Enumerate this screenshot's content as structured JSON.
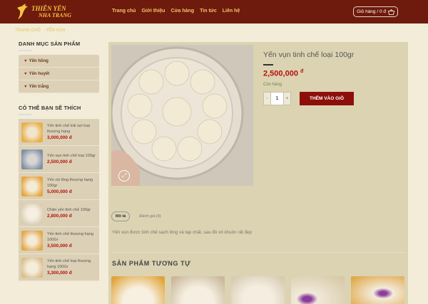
{
  "brand": {
    "line1": "THIÊN YẾN",
    "line2": "NHA TRANG"
  },
  "nav": [
    "Trang chủ",
    "Giới thiệu",
    "Cửa hàng",
    "Tin tức",
    "Liên hệ"
  ],
  "cart": {
    "label": "Giỏ hàng / 0 đ"
  },
  "breadcrumb": [
    "TRANG CHỦ",
    "YẾN VỤN"
  ],
  "sidebar": {
    "categories_title": "DANH MỤC SẢN PHẨM",
    "categories": [
      "Yến hồng",
      "Yến huyết",
      "Yến trắng"
    ],
    "suggest_title": "CÓ THỂ BẠN SẼ THÍCH",
    "products": [
      {
        "name": "Yến tinh chế trải sợi loại thượng hạng",
        "price": "3,000,000 đ"
      },
      {
        "name": "Yến vụn tinh chế loại 100gr",
        "price": "2,500,000 đ"
      },
      {
        "name": "Yến rút lông thượng hạng 100gr",
        "price": "5,000,000 đ"
      },
      {
        "name": "Chân yến tinh chế 100gr",
        "price": "2,800,000 đ"
      },
      {
        "name": "Yến tinh chế thượng hạng 100Gr",
        "price": "3,500,000 đ"
      },
      {
        "name": "Yến tinh chế loại thượng hạng 100Gr",
        "price": "3,300,000 đ"
      }
    ]
  },
  "product": {
    "title": "Yến vụn tinh chế loại 100gr",
    "price": "2,500,000",
    "currency": "đ",
    "stock": "Còn hàng",
    "quantity": "1",
    "qty_minus": "-",
    "qty_plus": "+",
    "add_to_cart": "THÊM VÀO GIỎ"
  },
  "tabs": {
    "description": "Mô tả",
    "reviews": "Đánh giá (0)"
  },
  "description_text": "Yến vụn được tinh chế sạch lông và tạp chất, sau đó vô khuôn rất đẹp",
  "related_title": "SẢN PHẨM TƯƠNG TỰ",
  "colors": {
    "header": "#6e1a0c",
    "accent": "#8c1009",
    "price": "#b5120e",
    "nav": "#f4c36a"
  }
}
